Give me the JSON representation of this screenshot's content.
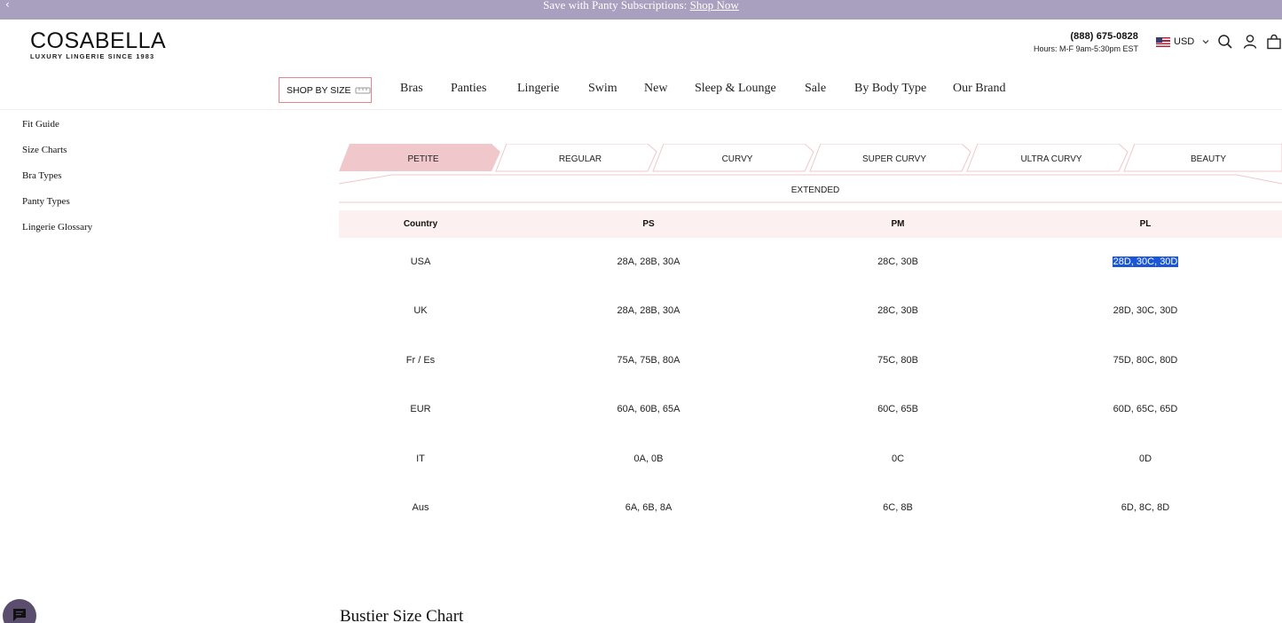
{
  "promo": {
    "back_icon": "chevron-left-icon",
    "text": "Save with Panty Subscriptions:",
    "link": "Shop Now"
  },
  "header": {
    "logo_name": "COSABELLA",
    "logo_tagline": "LUXURY LINGERIE SINCE 1983",
    "phone": "(888) 675-0828",
    "hours": "Hours: M-F 9am-5:30pm EST",
    "currency": "USD",
    "icons": [
      "flag-icon",
      "chevron-down-icon",
      "search-icon",
      "account-icon",
      "bag-icon"
    ]
  },
  "nav": {
    "shop_by_size": "SHOP BY SIZE",
    "items": [
      "Bras",
      "Panties",
      "Lingerie",
      "Swim",
      "New",
      "Sleep & Lounge",
      "Sale",
      "By Body Type",
      "Our Brand"
    ]
  },
  "sidebar": {
    "items": [
      "Fit Guide",
      "Size Charts",
      "Bra Types",
      "Panty Types",
      "Lingerie Glossary"
    ]
  },
  "tabs": {
    "items": [
      "PETITE",
      "REGULAR",
      "CURVY",
      "SUPER CURVY",
      "ULTRA CURVY",
      "BEAUTY"
    ],
    "active": "PETITE",
    "extended": "EXTENDED"
  },
  "table": {
    "headers": [
      "Country",
      "PS",
      "PM",
      "PL"
    ],
    "rows": [
      [
        "USA",
        "28A, 28B, 30A",
        "28C, 30B",
        "28D, 30C, 30D"
      ],
      [
        "UK",
        "28A, 28B, 30A",
        "28C, 30B",
        "28D, 30C, 30D"
      ],
      [
        "Fr / Es",
        "75A, 75B, 80A",
        "75C, 80B",
        "75D, 80C, 80D"
      ],
      [
        "EUR",
        "60A, 60B, 65A",
        "60C, 65B",
        "60D, 65C, 65D"
      ],
      [
        "IT",
        "0A, 0B",
        "0C",
        "0D"
      ],
      [
        "Aus",
        "6A, 6B, 8A",
        "6C, 8B",
        "6D, 8C, 8D"
      ]
    ],
    "selected_cell": "28D, 30C, 30D"
  },
  "section_title": "Bustier Size Chart",
  "chat": {
    "icon": "chat-icon"
  },
  "colors": {
    "promo_bg": "#a99fbf",
    "accent_pink": "#e3868b",
    "active_tab": "#f0c7cb",
    "header_row": "#fdf0f0",
    "selection": "#1a56d6"
  }
}
